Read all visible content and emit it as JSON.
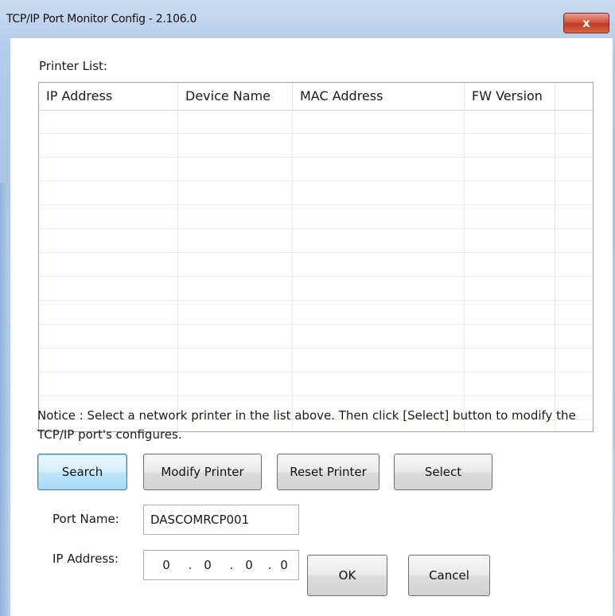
{
  "window": {
    "title": "TCP/IP Port Monitor Config - 2.106.0",
    "close_glyph": "x"
  },
  "printer_list": {
    "label": "Printer List:",
    "columns": [
      "IP Address",
      "Device Name",
      "MAC Address",
      "FW Version"
    ],
    "rows": []
  },
  "notice": "Notice : Select a network printer in the list above. Then click [Select] button to modify the TCP/IP port's configures.",
  "buttons": {
    "search": "Search",
    "modify_printer": "Modify Printer",
    "reset_printer": "Reset Printer",
    "select": "Select",
    "ok": "OK",
    "cancel": "Cancel"
  },
  "port_name": {
    "label": "Port Name:",
    "value": "DASCOMRCP001"
  },
  "ip_address": {
    "label": "IP Address:",
    "octets": [
      "0",
      "0",
      "0",
      "0"
    ],
    "separator": "."
  },
  "colors": {
    "frame": "#b5cde8",
    "close_button": "#c23a22",
    "default_button_border": "#3c7fb1"
  }
}
